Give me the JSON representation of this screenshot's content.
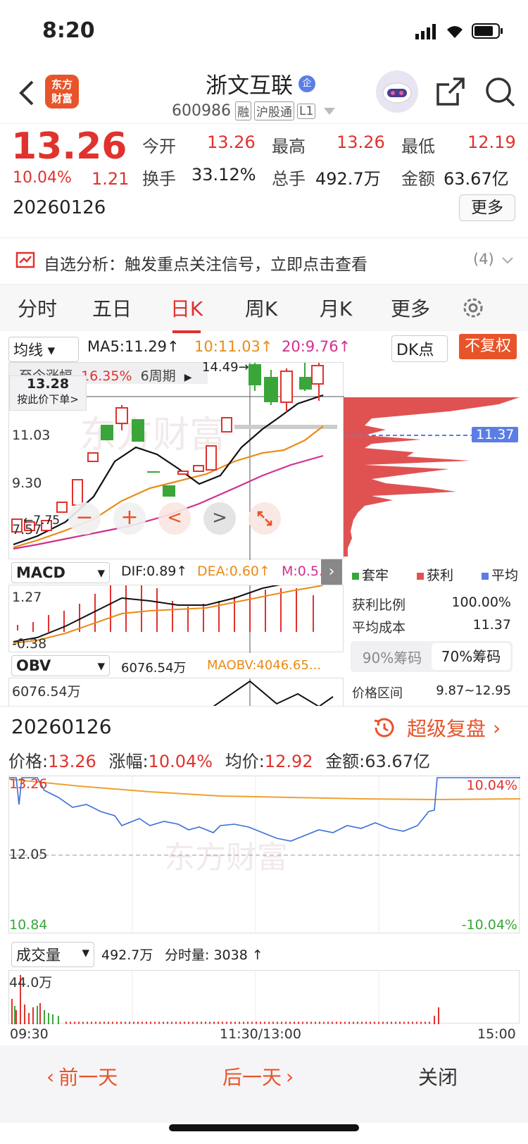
{
  "status": {
    "time": "8:20"
  },
  "header": {
    "stock_name": "浙文互联",
    "stock_tag": "企",
    "code": "600986",
    "badges": [
      "融",
      "沪股通",
      "L1"
    ],
    "logo_line1": "东方",
    "logo_line2": "财富"
  },
  "quote": {
    "price": "13.26",
    "change_pct": "10.04%",
    "change": "1.21",
    "date": "20260126",
    "open_label": "今开",
    "open": "13.26",
    "high_label": "最高",
    "high": "13.26",
    "low_label": "最低",
    "low": "12.19",
    "turnover_label": "换手",
    "turnover": "33.12%",
    "volume_label": "总手",
    "volume": "492.7万",
    "amount_label": "金额",
    "amount": "63.67亿",
    "more_label": "更多"
  },
  "alert": {
    "text": "自选分析：触发重点关注信号，立即点击查看",
    "count": "(4)"
  },
  "tabs": [
    "分时",
    "五日",
    "日K",
    "周K",
    "月K",
    "更多"
  ],
  "kline": {
    "ma_select": "均线",
    "ma5": "MA5:11.29",
    "ma10": "10:11.03",
    "ma20": "20:9.76",
    "dk_label": "DK点",
    "fuquan_label": "不复权",
    "rise_label": "至今涨幅",
    "rise_value": "16.35%",
    "rise_period": "6周期",
    "order_price": "13.28",
    "order_label": "按此价下单>",
    "high_mark": "14.49",
    "y_labels": [
      "11.03",
      "9.30",
      "7.57"
    ],
    "low_mark": "7.75",
    "watermark": "东方财富"
  },
  "chip": {
    "avg_tag": "11.37",
    "legend": [
      "套牢",
      "获利",
      "平均"
    ],
    "profit_ratio_label": "获利比例",
    "profit_ratio": "100.00%",
    "avg_cost_label": "平均成本",
    "avg_cost": "11.37",
    "chip90": "90%筹码",
    "chip70": "70%筹码",
    "range_label": "价格区间",
    "range": "9.87~12.95"
  },
  "macd": {
    "select": "MACD",
    "dif": "DIF:0.89",
    "dea": "DEA:0.60",
    "m": "M:0.5...",
    "top": "1.27",
    "bottom": "-0.38"
  },
  "obv": {
    "select": "OBV",
    "value": "6076.54万",
    "maobv": "MAOBV:4046.65...",
    "axis": "6076.54万"
  },
  "timeshare": {
    "date": "20260126",
    "replay_label": "超级复盘",
    "price_label": "价格:",
    "price": "13.26",
    "pct_label": "涨幅:",
    "pct": "10.04%",
    "avg_label": "均价:",
    "avg": "12.92",
    "amount_label": "金额:",
    "amount": "63.67亿",
    "y_top": "13.26",
    "y_mid": "12.05",
    "y_bot": "10.84",
    "pct_top": "10.04%",
    "pct_bot": "-10.04%",
    "vol_select": "成交量",
    "vol_total": "492.7万",
    "vol_minute": "分时量: 3038",
    "vol_axis": "44.0万",
    "times": [
      "09:30",
      "11:30/13:00",
      "15:00"
    ],
    "watermark": "东方财富"
  },
  "bottom": {
    "prev": "前一天",
    "next": "后一天",
    "close": "关闭"
  },
  "colors": {
    "up": "#e0322e",
    "down": "#3aa63a",
    "ma10": "#e98b16",
    "ma20": "#d0308f",
    "accent": "#e0322e"
  }
}
